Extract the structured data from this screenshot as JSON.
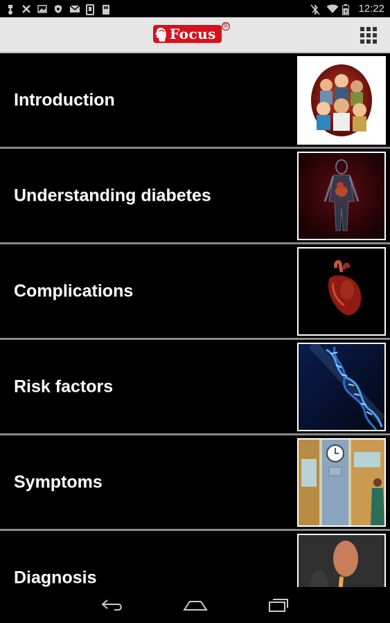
{
  "status_bar": {
    "time": "12:22",
    "left_icons": [
      "usb-icon",
      "close-x-icon",
      "image-icon",
      "shield-icon",
      "mail-icon",
      "sim-icon",
      "storage-icon"
    ],
    "right_icons": [
      "bluetooth-off-icon",
      "wifi-icon",
      "battery-icon"
    ]
  },
  "action_bar": {
    "logo_text": "Focus",
    "logo_reg": "®",
    "menu_icon": "grid-icon"
  },
  "list": {
    "items": [
      {
        "label": "Introduction",
        "thumb": "people-crowd"
      },
      {
        "label": "Understanding diabetes",
        "thumb": "human-body"
      },
      {
        "label": "Complications",
        "thumb": "heart"
      },
      {
        "label": "Risk factors",
        "thumb": "dna"
      },
      {
        "label": "Symptoms",
        "thumb": "restroom-doors"
      },
      {
        "label": "Diagnosis",
        "thumb": "finger-prick"
      }
    ]
  },
  "nav_bar": {
    "buttons": [
      "back-icon",
      "home-icon",
      "recent-apps-icon"
    ]
  },
  "colors": {
    "action_bar_bg": "#e6e6e6",
    "logo_red": "#d6121d",
    "list_bg": "#000000",
    "divider": "#8a8a8a"
  }
}
